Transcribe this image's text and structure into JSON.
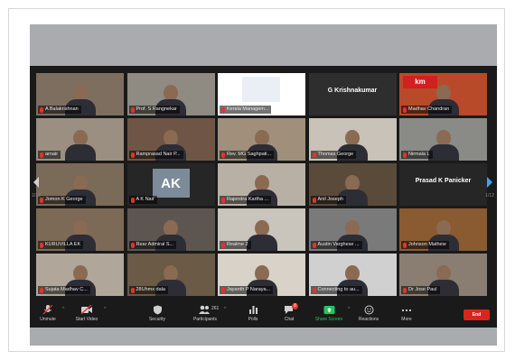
{
  "colors": {
    "speaker_outline": "#c9d400",
    "end_button": "#d9261c",
    "muted_mic": "#e5322e",
    "share_screen": "#22c55e"
  },
  "pagination": {
    "left": "1/12",
    "right": "1/12"
  },
  "tiles": [
    {
      "name": "A Balakrishnan",
      "active": true
    },
    {
      "name": "Prof. S Rangnekar"
    },
    {
      "name": "Kerala Managem..."
    },
    {
      "name": "",
      "display_text": "G Krishnakumar"
    },
    {
      "name": "Madhav Chandran",
      "logo": "km"
    },
    {
      "name": "arnair"
    },
    {
      "name": "Ramprasad Nair P..."
    },
    {
      "name": "Rev. MG Saghpati..."
    },
    {
      "name": "Thomas George"
    },
    {
      "name": "Nirmala L"
    },
    {
      "name": "Jomon K George"
    },
    {
      "name": "A K Nair",
      "initials": "AK"
    },
    {
      "name": "Rajendra Kartha ..."
    },
    {
      "name": "Anil Joseph"
    },
    {
      "name": "",
      "display_text": "Prasad K Panicker"
    },
    {
      "name": "KURUVILLA EK"
    },
    {
      "name": "Rear Admiral S..."
    },
    {
      "name": "Realme 2"
    },
    {
      "name": "Austin Varghese ..."
    },
    {
      "name": "Johnson Mathew"
    },
    {
      "name": "Sujata Madhav C..."
    },
    {
      "name": "28Uhmx dala"
    },
    {
      "name": "Jayanth P Naraya..."
    },
    {
      "name": "Connecting to au..."
    },
    {
      "name": "Dr Jose Paul"
    }
  ],
  "toolbar": {
    "unmute": "Unmute",
    "start_video": "Start Video",
    "security": "Security",
    "participants": "Participants",
    "participants_count": "261",
    "polls": "Polls",
    "chat": "Chat",
    "chat_badge": "8",
    "share_screen": "Share Screen",
    "reactions": "Reactions",
    "more": "More",
    "end": "End"
  }
}
